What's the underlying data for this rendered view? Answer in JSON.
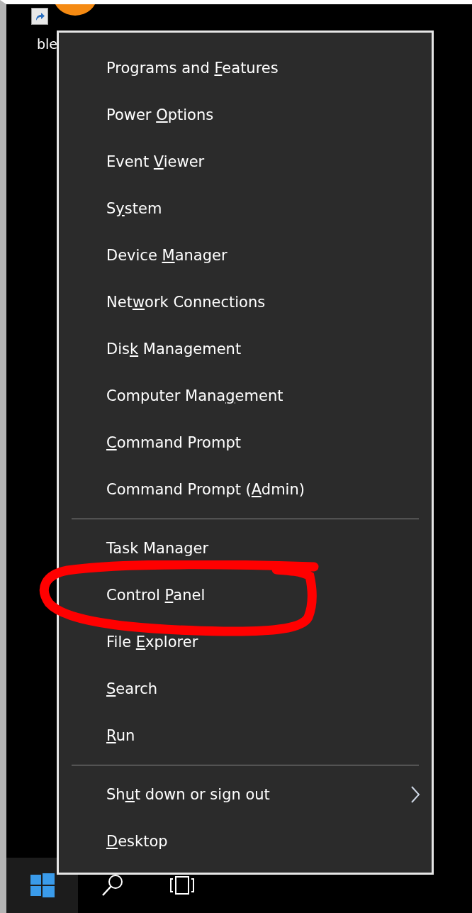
{
  "desktop_icons": [
    {
      "label": "ble"
    }
  ],
  "menu": {
    "groups": [
      [
        {
          "before": "Programs and ",
          "key": "F",
          "after": "eatures"
        },
        {
          "before": "Power ",
          "key": "O",
          "after": "ptions"
        },
        {
          "before": "Event ",
          "key": "V",
          "after": "iewer"
        },
        {
          "before": "S",
          "key": "y",
          "after": "stem"
        },
        {
          "before": "Device ",
          "key": "M",
          "after": "anager"
        },
        {
          "before": "Net",
          "key": "w",
          "after": "ork Connections"
        },
        {
          "before": "Dis",
          "key": "k",
          "after": " Management"
        },
        {
          "before": "Computer Mana",
          "key": "g",
          "after": "ement"
        },
        {
          "key": "C",
          "after": "ommand Prompt"
        },
        {
          "before": "Command Prompt (",
          "key": "A",
          "after": "dmin)"
        }
      ],
      [
        {
          "before": "Task Manager"
        },
        {
          "before": "Control ",
          "key": "P",
          "after": "anel"
        },
        {
          "before": "File ",
          "key": "E",
          "after": "xplorer"
        },
        {
          "key": "S",
          "after": "earch"
        },
        {
          "key": "R",
          "after": "un"
        }
      ],
      [
        {
          "before": "Sh",
          "key": "u",
          "after": "t down or sign out",
          "submenu": true
        },
        {
          "key": "D",
          "after": "esktop"
        }
      ]
    ]
  }
}
